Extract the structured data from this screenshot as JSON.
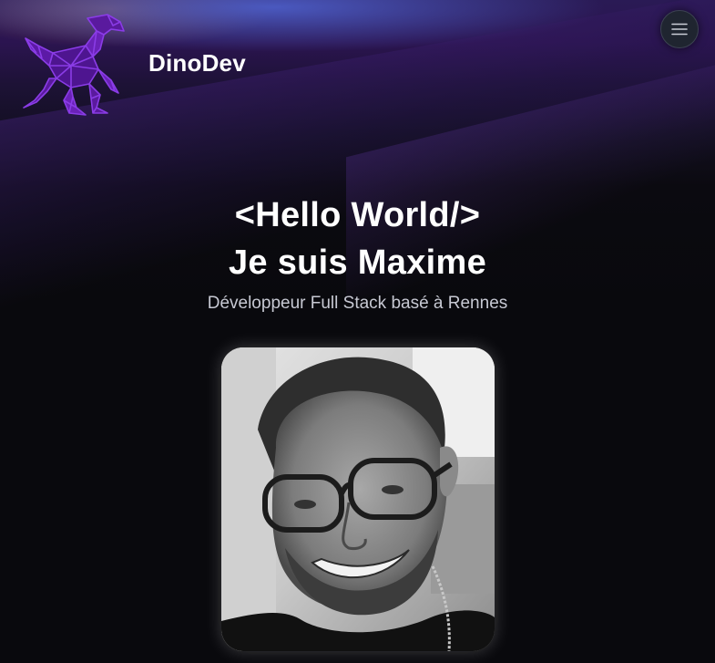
{
  "header": {
    "brand": "DinoDev",
    "logo_icon": "raptor-logo-icon",
    "menu_icon": "hamburger-menu-icon"
  },
  "hero": {
    "line1": "<Hello World/>",
    "line2": "Je suis Maxime",
    "subtitle": "Développeur Full Stack basé à Rennes"
  },
  "photo": {
    "alt": "Portrait de Maxime"
  },
  "colors": {
    "logo_purple": "#7a2fd6",
    "background": "#09090d",
    "header_glow": "#2b1450",
    "text": "#ffffff",
    "subtitle_text": "#c7c9d3"
  }
}
